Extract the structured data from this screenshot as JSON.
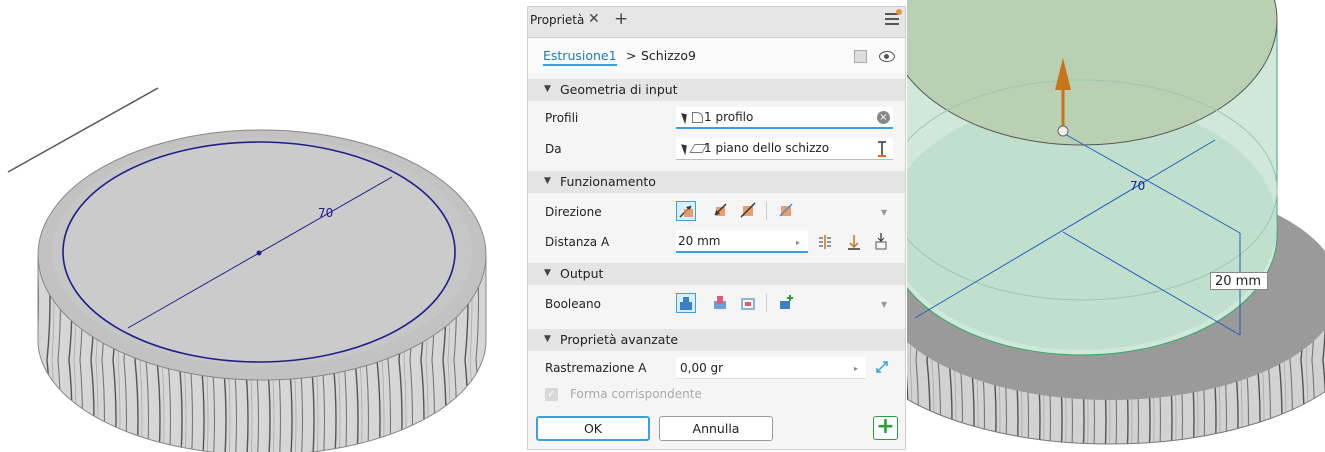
{
  "panel": {
    "tab_title": "Proprietà",
    "breadcrumb": {
      "feature": "Estrusione1",
      "separator": ">",
      "sketch": "Schizzo9"
    },
    "sections": {
      "input": {
        "title": "Geometria di input"
      },
      "behavior": {
        "title": "Funzionamento"
      },
      "output": {
        "title": "Output"
      },
      "advanced": {
        "title": "Proprietà avanzate"
      }
    },
    "profiles": {
      "label": "Profili",
      "value": "1 profilo"
    },
    "from": {
      "label": "Da",
      "value": "1 piano dello schizzo"
    },
    "direction": {
      "label": "Direzione"
    },
    "distance": {
      "label": "Distanza A",
      "value": "20 mm"
    },
    "boolean": {
      "label": "Booleano"
    },
    "taper": {
      "label": "Rastremazione A",
      "value": "0,00 gr"
    },
    "match_shape": {
      "label": "Forma corrispondente",
      "checked": true,
      "enabled": false
    },
    "buttons": {
      "ok": "OK",
      "cancel": "Annulla",
      "apply": "+"
    }
  },
  "viewport_left": {
    "dimension_label": "70"
  },
  "viewport_right": {
    "dimension_label": "70",
    "height_label": "20 mm"
  },
  "colors": {
    "accent": "#3aa0e0",
    "sketch_circle": "#1f1f8c",
    "extrude_fill": "#cfe8d9",
    "arrow": "#c8741a",
    "apply_green": "#2e9c3e"
  }
}
